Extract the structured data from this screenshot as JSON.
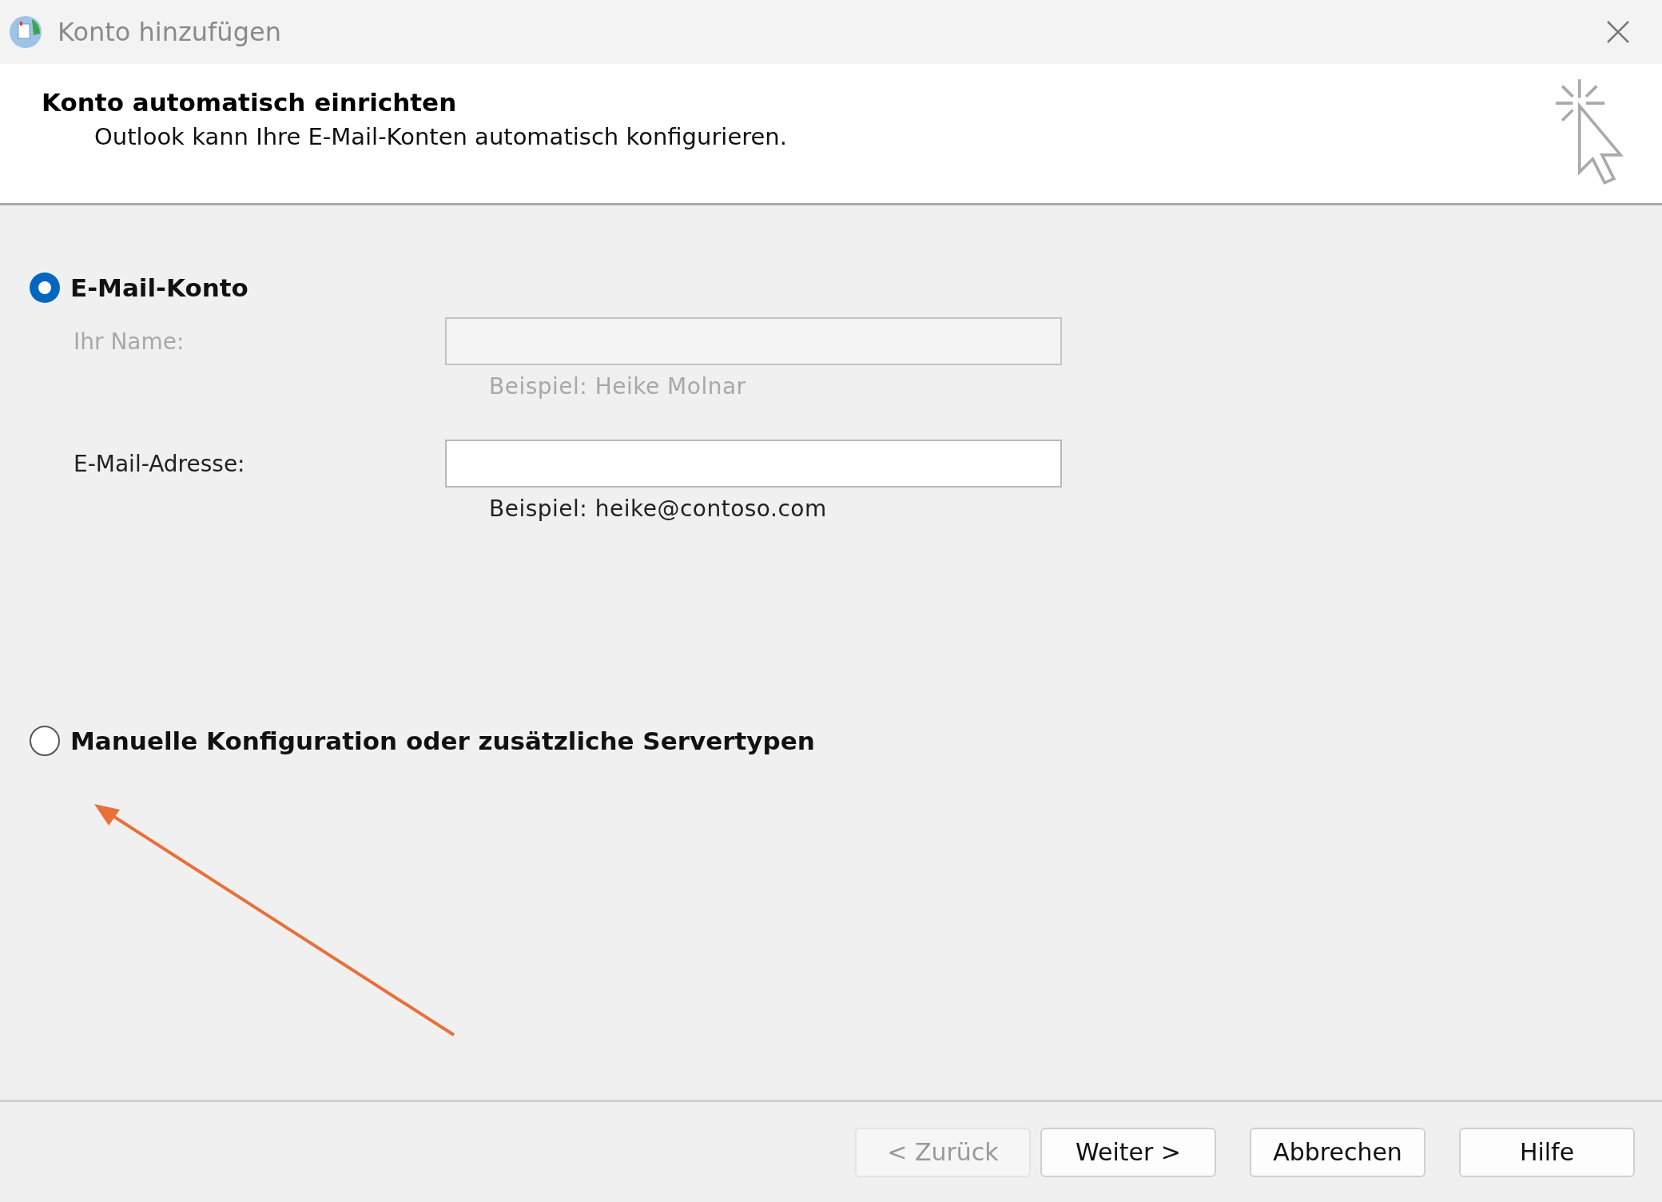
{
  "window": {
    "title": "Konto hinzufügen"
  },
  "header": {
    "title": "Konto automatisch einrichten",
    "subtitle": "Outlook kann Ihre E-Mail-Konten automatisch konfigurieren."
  },
  "options": [
    {
      "label": "E-Mail-Konto",
      "selected": true,
      "fields": [
        {
          "label": "Ihr Name:",
          "example": "Beispiel: Heike Molnar",
          "disabled": true
        },
        {
          "label": "E-Mail-Adresse:",
          "example": "Beispiel: heike@contoso.com",
          "disabled": false
        }
      ]
    },
    {
      "label": "Manuelle Konfiguration oder zusätzliche Servertypen",
      "selected": false
    }
  ],
  "buttons": [
    {
      "label": "< Zurück",
      "disabled": true
    },
    {
      "label": "Weiter >",
      "disabled": false
    },
    {
      "label": "Abbrechen",
      "disabled": false
    },
    {
      "label": "Hilfe",
      "disabled": false
    }
  ]
}
